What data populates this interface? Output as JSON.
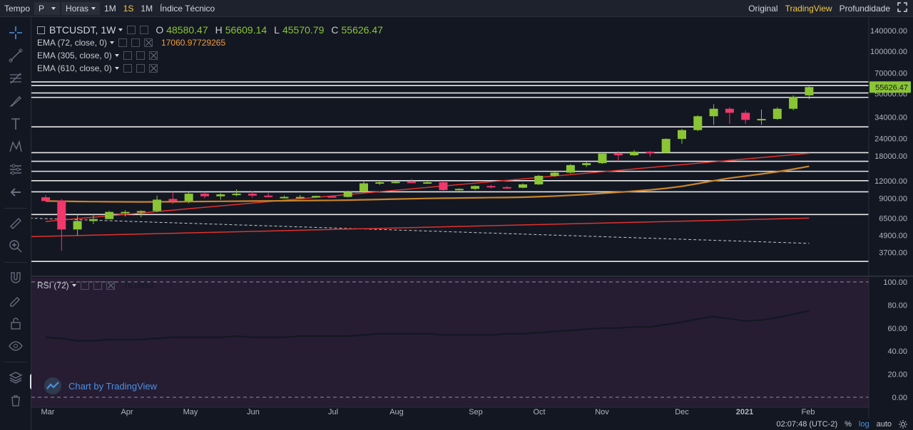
{
  "toolbar": {
    "tempo_label": "Tempo",
    "style_select": "P",
    "interval_select": "Horas",
    "intervals": [
      "1M",
      "1S",
      "1M"
    ],
    "active_interval_index": 1,
    "indicators_label": "Índice Técnico",
    "views": [
      "Original",
      "TradingView",
      "Profundidade"
    ],
    "active_view_index": 1,
    "fullscreen_icon": "expand-icon"
  },
  "legend": {
    "symbol": "BTCUSDT, 1W",
    "open_key": "O",
    "open": "48580.47",
    "high_key": "H",
    "high": "56609.14",
    "low_key": "L",
    "low": "45570.79",
    "close_key": "C",
    "close": "55626.47",
    "ema72": "EMA (72, close, 0)",
    "ema72_value": "17060.97729265",
    "ema305": "EMA (305, close, 0)",
    "ema610": "EMA (610, close, 0)",
    "rsi": "RSI (72)",
    "rsi_value": "75.0852"
  },
  "brand": {
    "text": "Chart by TradingView"
  },
  "bottom": {
    "time": "02:07:48 (UTC-2)",
    "percent": "%",
    "log": "log",
    "auto": "auto"
  },
  "colors": {
    "background": "#131722",
    "rsi_background": "#261d33",
    "up": "#8ac535",
    "down": "#f0386b",
    "ema_orange": "#c8842b",
    "trend_red": "#e0322e",
    "level_white": "#e8e8e8",
    "price_label": "#8ac535"
  },
  "chart_data": {
    "type": "candlestick",
    "scale": "log",
    "x_labels": [
      "Mar",
      "Apr",
      "May",
      "Jun",
      "Jul",
      "Aug",
      "Sep",
      "Oct",
      "Nov",
      "Dec",
      "2021",
      "Feb"
    ],
    "y_ticks": [
      3700,
      4900,
      6500,
      9000,
      12000,
      18000,
      24000,
      34000,
      50000,
      70000,
      100000,
      140000
    ],
    "ylim": [
      2600,
      175000
    ],
    "last_price": 55626.47,
    "candles": [
      {
        "o": 9150,
        "h": 9500,
        "l": 8600,
        "c": 8600
      },
      {
        "o": 8700,
        "h": 8900,
        "l": 3800,
        "c": 5400
      },
      {
        "o": 5400,
        "h": 6900,
        "l": 4900,
        "c": 6200
      },
      {
        "o": 6200,
        "h": 6900,
        "l": 5900,
        "c": 6400
      },
      {
        "o": 6400,
        "h": 7300,
        "l": 6400,
        "c": 7200
      },
      {
        "o": 7200,
        "h": 7400,
        "l": 6700,
        "c": 7200
      },
      {
        "o": 7200,
        "h": 7400,
        "l": 6600,
        "c": 7300
      },
      {
        "o": 7300,
        "h": 9400,
        "l": 7200,
        "c": 8800
      },
      {
        "o": 8900,
        "h": 10000,
        "l": 8200,
        "c": 8600
      },
      {
        "o": 8600,
        "h": 10000,
        "l": 8300,
        "c": 9700
      },
      {
        "o": 9700,
        "h": 10000,
        "l": 9000,
        "c": 9300
      },
      {
        "o": 9300,
        "h": 9800,
        "l": 8800,
        "c": 9600
      },
      {
        "o": 9500,
        "h": 10400,
        "l": 9300,
        "c": 9700
      },
      {
        "o": 9700,
        "h": 10100,
        "l": 9100,
        "c": 9400
      },
      {
        "o": 9400,
        "h": 9800,
        "l": 9100,
        "c": 9200
      },
      {
        "o": 9200,
        "h": 9400,
        "l": 9000,
        "c": 9200
      },
      {
        "o": 9200,
        "h": 9500,
        "l": 9000,
        "c": 9200
      },
      {
        "o": 9200,
        "h": 9400,
        "l": 9100,
        "c": 9350
      },
      {
        "o": 9300,
        "h": 9450,
        "l": 9150,
        "c": 9200
      },
      {
        "o": 9200,
        "h": 10200,
        "l": 9100,
        "c": 10000
      },
      {
        "o": 10000,
        "h": 12000,
        "l": 10000,
        "c": 11500
      },
      {
        "o": 11500,
        "h": 12100,
        "l": 11200,
        "c": 11700
      },
      {
        "o": 11700,
        "h": 11950,
        "l": 11500,
        "c": 11800
      },
      {
        "o": 11800,
        "h": 12400,
        "l": 11600,
        "c": 11600
      },
      {
        "o": 11600,
        "h": 11800,
        "l": 11400,
        "c": 11700
      },
      {
        "o": 11700,
        "h": 12000,
        "l": 10000,
        "c": 10300
      },
      {
        "o": 10300,
        "h": 10600,
        "l": 10200,
        "c": 10500
      },
      {
        "o": 10500,
        "h": 11100,
        "l": 10300,
        "c": 11000
      },
      {
        "o": 11000,
        "h": 11200,
        "l": 10600,
        "c": 10800
      },
      {
        "o": 10800,
        "h": 11000,
        "l": 10500,
        "c": 10700
      },
      {
        "o": 10700,
        "h": 11500,
        "l": 10600,
        "c": 11300
      },
      {
        "o": 11300,
        "h": 13200,
        "l": 11200,
        "c": 13000
      },
      {
        "o": 13000,
        "h": 13900,
        "l": 12800,
        "c": 13700
      },
      {
        "o": 13700,
        "h": 15800,
        "l": 13500,
        "c": 15500
      },
      {
        "o": 15500,
        "h": 16300,
        "l": 15000,
        "c": 16000
      },
      {
        "o": 16000,
        "h": 19000,
        "l": 15800,
        "c": 18700
      },
      {
        "o": 18700,
        "h": 19500,
        "l": 16500,
        "c": 18200
      },
      {
        "o": 18200,
        "h": 19800,
        "l": 18000,
        "c": 19300
      },
      {
        "o": 19300,
        "h": 19500,
        "l": 17800,
        "c": 19000
      },
      {
        "o": 19000,
        "h": 24000,
        "l": 18800,
        "c": 23800
      },
      {
        "o": 23800,
        "h": 28000,
        "l": 22000,
        "c": 27500
      },
      {
        "o": 27500,
        "h": 35000,
        "l": 27000,
        "c": 34500
      },
      {
        "o": 34500,
        "h": 42000,
        "l": 30000,
        "c": 39000
      },
      {
        "o": 39000,
        "h": 40000,
        "l": 30500,
        "c": 36500
      },
      {
        "o": 36500,
        "h": 38000,
        "l": 30500,
        "c": 32500
      },
      {
        "o": 32500,
        "h": 38500,
        "l": 30000,
        "c": 33000
      },
      {
        "o": 33000,
        "h": 40000,
        "l": 32500,
        "c": 39000
      },
      {
        "o": 39000,
        "h": 48500,
        "l": 38000,
        "c": 47500
      },
      {
        "o": 48580.47,
        "h": 56609.14,
        "l": 45570.79,
        "c": 55626.47
      }
    ],
    "ema72": [
      8600,
      8580,
      8540,
      8520,
      8500,
      8490,
      8480,
      8490,
      8500,
      8520,
      8540,
      8560,
      8580,
      8600,
      8620,
      8640,
      8660,
      8680,
      8700,
      8730,
      8780,
      8830,
      8880,
      8930,
      8980,
      9010,
      9040,
      9070,
      9100,
      9120,
      9160,
      9240,
      9330,
      9450,
      9580,
      9760,
      9930,
      10120,
      10320,
      10600,
      10950,
      11450,
      12000,
      12520,
      12950,
      13400,
      13900,
      14500,
      15200
    ],
    "trend_lines": [
      {
        "color": "trend_red",
        "points": [
          [
            0,
            6150
          ],
          [
            48,
            18800
          ]
        ]
      },
      {
        "color": "trend_red",
        "points": [
          [
            -1,
            4800
          ],
          [
            48,
            6500
          ]
        ]
      }
    ],
    "dashed_lines": [
      {
        "points": [
          [
            -1,
            6500
          ],
          [
            48,
            4300
          ]
        ]
      }
    ],
    "levels": [
      60500,
      57000,
      50500,
      47000,
      29000,
      19000,
      16500,
      14000,
      12000,
      10000,
      6900,
      3200
    ],
    "rsi": {
      "ylim": [
        0,
        100
      ],
      "ticks": [
        0,
        20,
        40,
        60,
        80,
        100
      ],
      "values": [
        52,
        51,
        49,
        49,
        50,
        50,
        50,
        51,
        52,
        52,
        52,
        52,
        53,
        52,
        52,
        52,
        53,
        53,
        53,
        53,
        54,
        55,
        55,
        55,
        55,
        54,
        54,
        54,
        54,
        55,
        55,
        56,
        57,
        58,
        59,
        60,
        60,
        61,
        61,
        63,
        65,
        68,
        70,
        68,
        66,
        67,
        69,
        72,
        75
      ]
    }
  }
}
